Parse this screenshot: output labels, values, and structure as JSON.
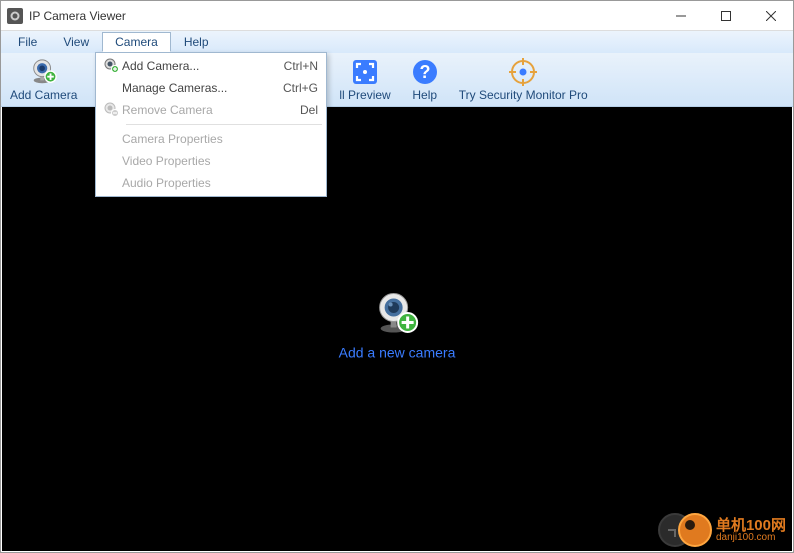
{
  "titlebar": {
    "title": "IP Camera Viewer"
  },
  "menubar": {
    "file": "File",
    "view": "View",
    "camera": "Camera",
    "help": "Help"
  },
  "toolbar": {
    "add_camera": "Add Camera",
    "full_preview": "ll Preview",
    "help": "Help",
    "try_pro": "Try Security Monitor Pro"
  },
  "dropdown": {
    "add_camera": "Add Camera...",
    "add_camera_short": "Ctrl+N",
    "manage_cameras": "Manage Cameras...",
    "manage_cameras_short": "Ctrl+G",
    "remove_camera": "Remove Camera",
    "remove_camera_short": "Del",
    "camera_properties": "Camera Properties",
    "video_properties": "Video Properties",
    "audio_properties": "Audio Properties"
  },
  "content": {
    "add_new_camera": "Add a new camera"
  },
  "watermark": {
    "line1": "单机100网",
    "line2": "danji100.com"
  }
}
